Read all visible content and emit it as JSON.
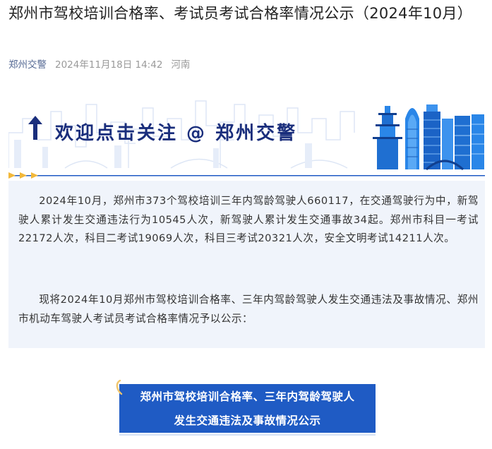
{
  "article": {
    "title": "郑州市驾校培训合格率、考试员考试合格率情况公示（2024年10月）",
    "author": "郑州交警",
    "publish_time": "2024年11月18日 14:42",
    "location": "河南"
  },
  "banner": {
    "text": "欢迎点击关注 @ 郑州交警",
    "accent_color": "#1a2e7c"
  },
  "body": {
    "paragraphs": [
      "2024年10月，郑州市373个驾校培训三年内驾龄驾驶人660117，在交通驾驶行为中，新驾驶人累计发生交通违法行为10545人次，新驾驶人累计发生交通事故34起。郑州市科目一考试22172人次，科目二考试19069人次，科目三考试20321人次，安全文明考试14211人次。",
      "现将2024年10月郑州市驾校培训合格率、三年内驾龄驾驶人发生交通违法及事故情况、郑州市机动车驾驶人考试员考试合格率情况予以公示："
    ]
  },
  "section_heading": {
    "line1": "郑州市驾校培训合格率、三年内驾龄驾驶人",
    "line2": "发生交通违法及事故情况公示",
    "background_color": "#1f5bc4"
  }
}
